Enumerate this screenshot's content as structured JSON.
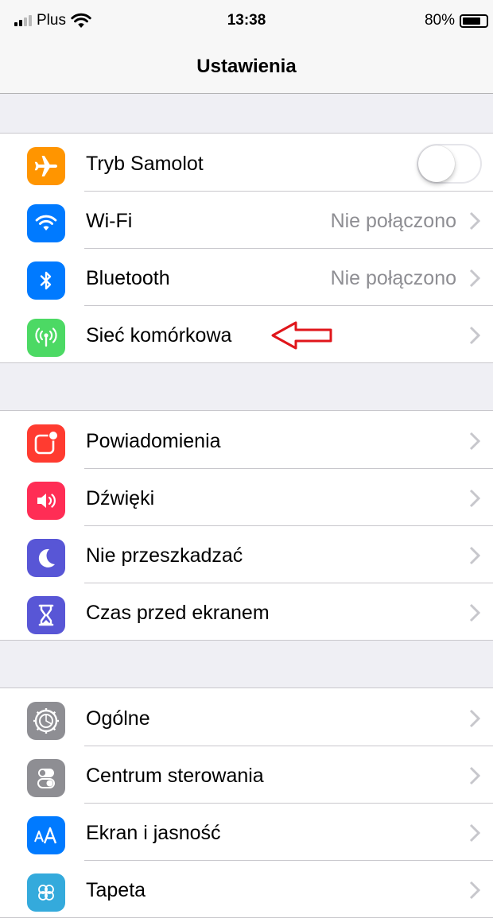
{
  "status_bar": {
    "carrier": "Plus",
    "time": "13:38",
    "battery_percent_label": "80%",
    "battery_level": 0.8
  },
  "nav": {
    "title": "Ustawienia"
  },
  "groups": [
    {
      "items": [
        {
          "label": "Tryb Samolot",
          "icon": "airplane-icon",
          "icon_color": "#ff9500",
          "toggle": false
        },
        {
          "label": "Wi-Fi",
          "icon": "wifi-icon",
          "icon_color": "#007aff",
          "detail": "Nie połączono"
        },
        {
          "label": "Bluetooth",
          "icon": "bluetooth-icon",
          "icon_color": "#007aff",
          "detail": "Nie połączono"
        },
        {
          "label": "Sieć komórkowa",
          "icon": "cellular-antenna-icon",
          "icon_color": "#4cd964",
          "annotation": "red-arrow-icon"
        }
      ]
    },
    {
      "items": [
        {
          "label": "Powiadomienia",
          "icon": "notifications-icon",
          "icon_color": "#ff3b30"
        },
        {
          "label": "Dźwięki",
          "icon": "speaker-icon",
          "icon_color": "#ff2d55"
        },
        {
          "label": "Nie przeszkadzać",
          "icon": "moon-icon",
          "icon_color": "#5856d6"
        },
        {
          "label": "Czas przed ekranem",
          "icon": "hourglass-icon",
          "icon_color": "#5856d6"
        }
      ]
    },
    {
      "items": [
        {
          "label": "Ogólne",
          "icon": "gear-icon",
          "icon_color": "#8e8e93"
        },
        {
          "label": "Centrum sterowania",
          "icon": "toggles-icon",
          "icon_color": "#8e8e93"
        },
        {
          "label": "Ekran i jasność",
          "icon": "text-size-icon",
          "icon_color": "#007aff"
        },
        {
          "label": "Tapeta",
          "icon": "wallpaper-icon",
          "icon_color": "#34aadc"
        }
      ]
    }
  ],
  "colors": {
    "annotation_arrow": "#e0161b",
    "chevron": "#c7c7cc",
    "detail_text": "#8e8e93"
  }
}
